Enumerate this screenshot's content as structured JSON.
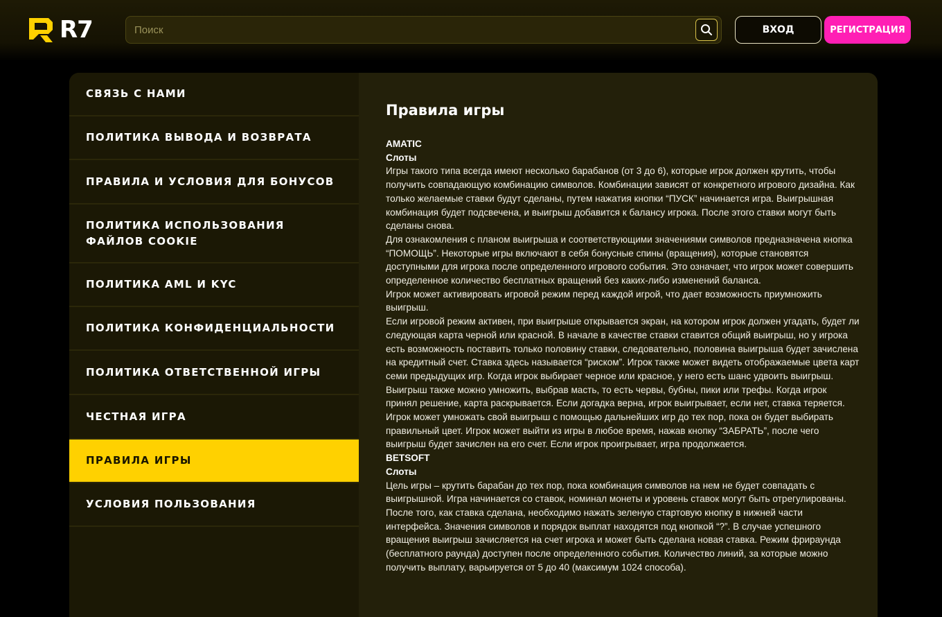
{
  "header": {
    "logo_text": "R7",
    "search_placeholder": "Поиск",
    "search_icon": "search-icon",
    "login_label": "ВХОД",
    "register_label": "РЕГИСТРАЦИЯ"
  },
  "colors": {
    "accent_yellow": "#ffd100",
    "register_pink": "#ff1fb4"
  },
  "sidebar": {
    "items": [
      {
        "label": "СВЯЗЬ С НАМИ",
        "active": false
      },
      {
        "label": "ПОЛИТИКА ВЫВОДА И ВОЗВРАТА",
        "active": false
      },
      {
        "label": "ПРАВИЛА И УСЛОВИЯ ДЛЯ БОНУСОВ",
        "active": false
      },
      {
        "label": "ПОЛИТИКА ИСПОЛЬЗОВАНИЯ ФАЙЛОВ COOKIE",
        "active": false
      },
      {
        "label": "ПОЛИТИКА AML И KYC",
        "active": false
      },
      {
        "label": "ПОЛИТИКА КОНФИДЕНЦИАЛЬНОСТИ",
        "active": false
      },
      {
        "label": "ПОЛИТИКА ОТВЕТСТВЕННОЙ ИГРЫ",
        "active": false
      },
      {
        "label": "ЧЕСТНАЯ ИГРА",
        "active": false
      },
      {
        "label": "ПРАВИЛА ИГРЫ",
        "active": true
      },
      {
        "label": "УСЛОВИЯ ПОЛЬЗОВАНИЯ",
        "active": false
      }
    ]
  },
  "main": {
    "title": "Правила игры",
    "sections": [
      {
        "provider": "AMATIC",
        "subtitle": "Слоты",
        "paragraphs": [
          "Игры такого типа всегда имеют несколько барабанов (от 3 до 6), которые игрок должен крутить, чтобы получить совпадающую комбинацию символов. Комбинации зависят от конкретного игрового дизайна. Как только желаемые ставки будут сделаны, путем нажатия кнопки “ПУСК” начинается игра. Выигрышная комбинация будет подсвечена, и выигрыш добавится к балансу игрока. После этого ставки могут быть сделаны снова.",
          "Для ознакомления с планом выигрыша и соответствующими значениями символов предназначена кнопка “ПОМОЩЬ”. Некоторые игры включают в себя бонусные спины (вращения), которые становятся доступными для игрока после определенного игрового события. Это означает, что игрок может совершить определенное количество бесплатных вращений без каких-либо изменений баланса.",
          "Игрок может активировать игровой режим перед каждой игрой, что дает возможность приумножить выигрыш.",
          "Если игровой режим активен, при выигрыше открывается экран, на котором игрок должен угадать, будет ли следующая карта черной или красной. В начале в качестве ставки ставится общий выигрыш, но у игрока есть возможность поставить только половину ставки, следовательно, половина выигрыша будет зачислена на кредитный счет. Ставка здесь называется “риском”. Игрок также может видеть отображаемые цвета карт семи предыдущих игр. Когда игрок выбирает черное или красное, у него есть шанс удвоить выигрыш. Выигрыш также можно умножить, выбрав масть, то есть червы, бубны, пики или трефы. Когда игрок принял решение, карта раскрывается. Если догадка верна, игрок выигрывает, если нет, ставка теряется. Игрок может умножать свой выигрыш с помощью дальнейших игр до тех пор, пока он будет выбирать правильный цвет. Игрок может выйти из игры в любое время, нажав кнопку “ЗАБРАТЬ”, после чего выигрыш будет зачислен на его счет. Если игрок проигрывает, игра продолжается."
        ]
      },
      {
        "provider": "BETSOFT",
        "subtitle": "Слоты",
        "paragraphs": [
          "Цель игры – крутить барабан до тех пор, пока комбинация символов на нем не будет совпадать с выигрышной. Игра начинается со ставок, номинал монеты и уровень ставок могут быть отрегулированы. После того, как ставка сделана, необходимо нажать зеленую стартовую кнопку в нижней части интерфейса. Значения символов и порядок выплат находятся под кнопкой “?”. В случае успешного вращения выигрыш зачисляется на счет игрока и может быть сделана новая ставка. Режим фрираунда (бесплатного раунда) доступен после определенного события. Количество линий, за которые можно получить выплату, варьируется от 5 до 40 (максимум 1024 способа)."
        ]
      }
    ]
  }
}
